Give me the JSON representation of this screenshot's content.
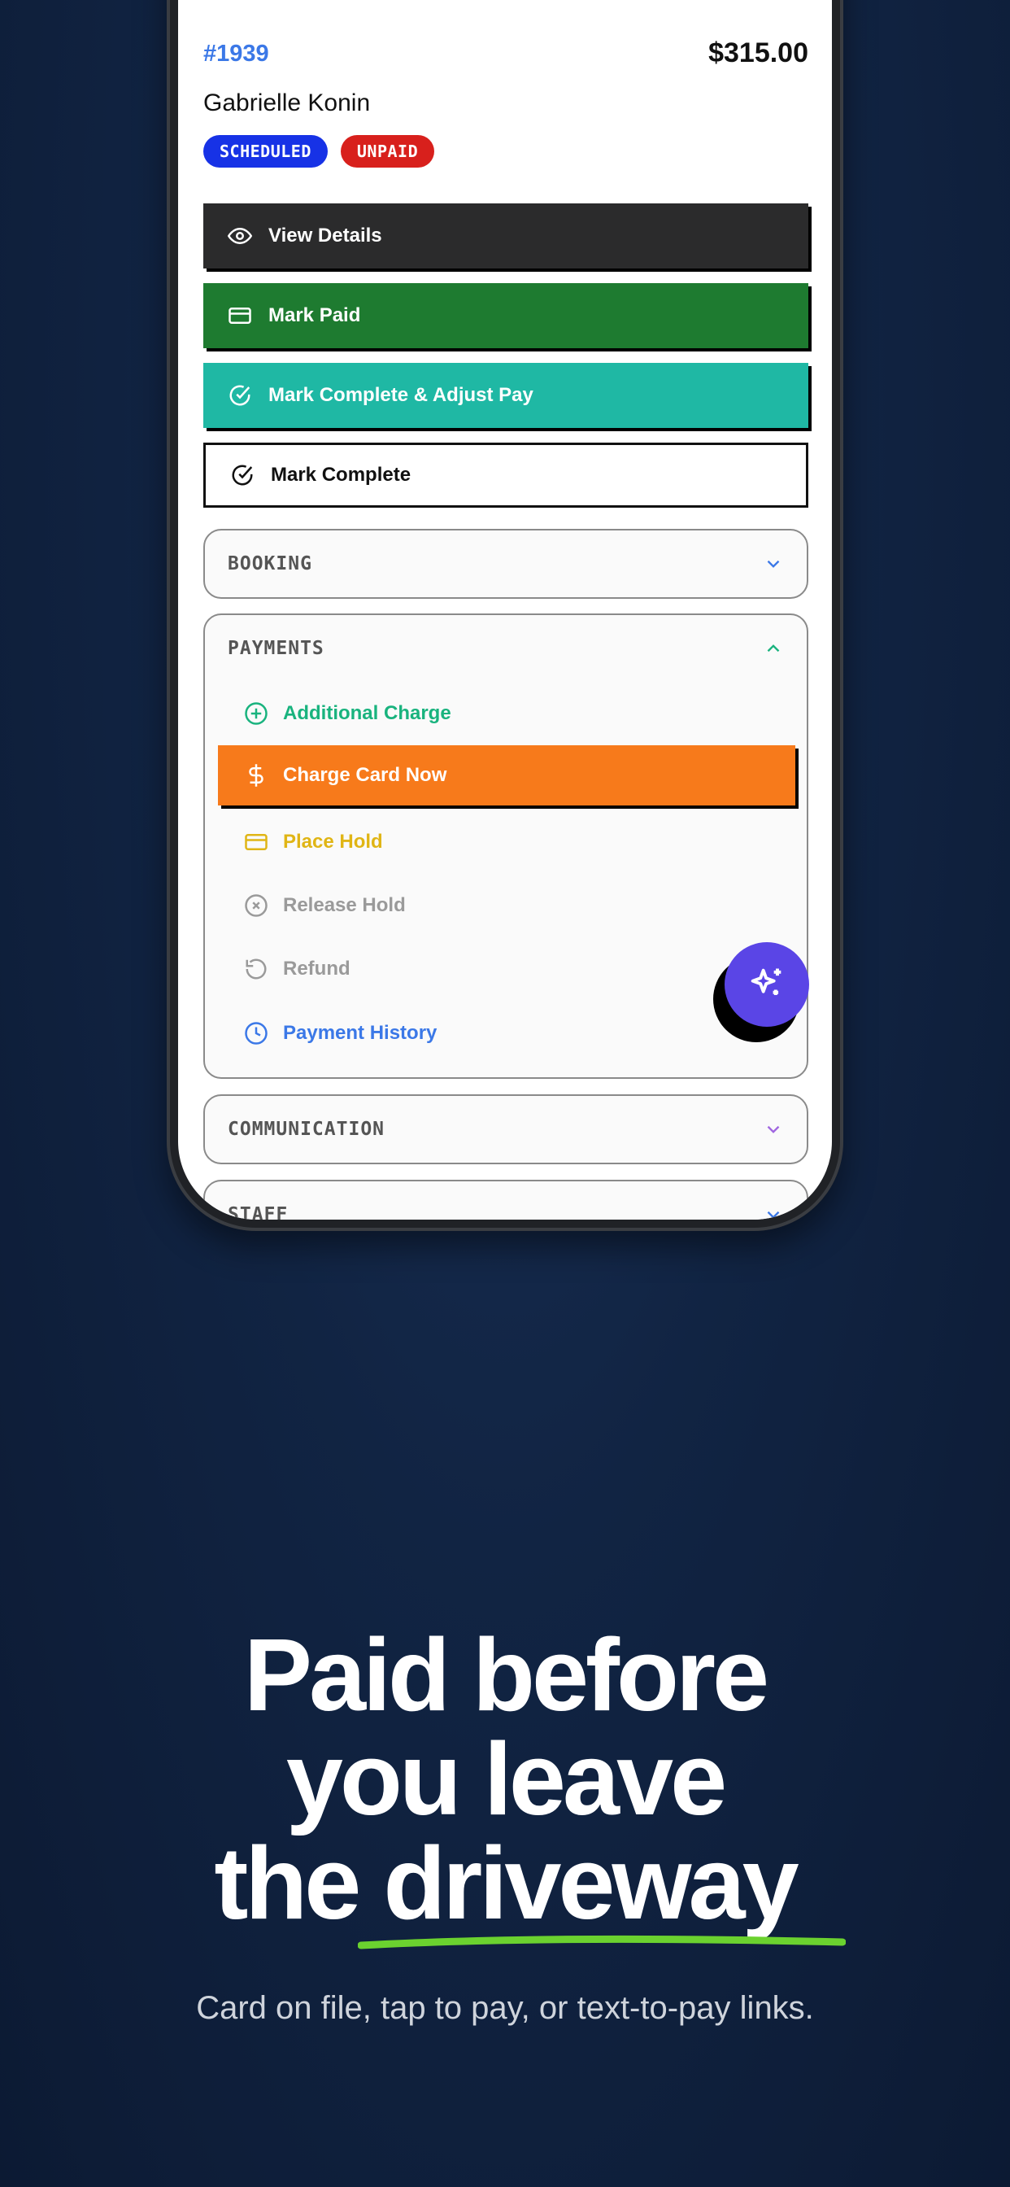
{
  "order": {
    "id": "#1939",
    "amount": "$315.00",
    "customer": "Gabrielle Konin",
    "badges": [
      "SCHEDULED",
      "UNPAID"
    ]
  },
  "actions": {
    "view_details": "View Details",
    "mark_paid": "Mark Paid",
    "mark_complete_adjust": "Mark Complete & Adjust Pay",
    "mark_complete": "Mark Complete"
  },
  "sections": {
    "booking": "BOOKING",
    "payments": "PAYMENTS",
    "communication": "COMMUNICATION",
    "staff": "STAFF"
  },
  "payments_menu": [
    {
      "label": "Additional Charge",
      "icon": "plus-circle-icon"
    },
    {
      "label": "Charge Card Now",
      "icon": "dollar-icon"
    },
    {
      "label": "Place Hold",
      "icon": "card-icon"
    },
    {
      "label": "Release Hold",
      "icon": "x-circle-icon"
    },
    {
      "label": "Refund",
      "icon": "undo-icon"
    },
    {
      "label": "Payment History",
      "icon": "clock-icon"
    }
  ],
  "marketing": {
    "line1": "Paid before",
    "line2": "you leave",
    "line3": "the driveway",
    "subtitle": "Card on file, tap to pay, or text-to-pay links."
  },
  "colors": {
    "accent_blue": "#3b78e7",
    "green": "#1e7b30",
    "teal": "#1fb8a4",
    "orange": "#f77a1b",
    "fab_purple": "#5a45e6",
    "underline_green": "#6bd22f"
  }
}
